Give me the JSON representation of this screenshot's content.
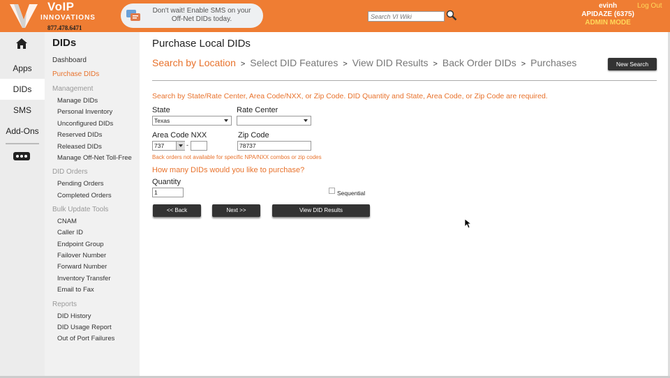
{
  "header": {
    "brand_name": "VoIP",
    "brand_sub": "INNOVATIONS",
    "brand_phone": "877.478.6471",
    "promo_line1": "Don't wait! Enable SMS on your",
    "promo_line2": "Off-Net DIDs today.",
    "search_placeholder": "Search VI Wiki",
    "user_name": "evinh",
    "account": "APIDAZE (6375)",
    "mode": "ADMIN MODE",
    "logout_label": "Log Out",
    "color_accent": "#ef7d33"
  },
  "icon_nav": {
    "home_icon": "home-icon",
    "items": [
      {
        "label": "Apps"
      },
      {
        "label": "DIDs"
      },
      {
        "label": "SMS"
      },
      {
        "label": "Add-Ons"
      }
    ],
    "more_icon": "more-dots-icon"
  },
  "sidebar": {
    "title": "DIDs",
    "dashboard": "Dashboard",
    "purchase": "Purchase DIDs",
    "management_head": "Management",
    "management": [
      "Manage DIDs",
      "Personal Inventory",
      "Unconfigured DIDs",
      "Reserved DIDs",
      "Released DIDs",
      "Manage Off-Net Toll-Free"
    ],
    "orders_head": "DID Orders",
    "orders": [
      "Pending Orders",
      "Completed Orders"
    ],
    "bulk_head": "Bulk Update Tools",
    "bulk": [
      "CNAM",
      "Caller ID",
      "Endpoint Group",
      "Failover Number",
      "Forward Number",
      "Inventory Transfer",
      "Email to Fax"
    ],
    "reports_head": "Reports",
    "reports": [
      "DID History",
      "DID Usage Report",
      "Out of Port Failures"
    ]
  },
  "main": {
    "title": "Purchase Local DIDs",
    "steps": [
      "Search by Location",
      "Select DID Features",
      "View DID Results",
      "Back Order DIDs",
      "Purchases"
    ],
    "step_sep": ">",
    "new_search": "New Search",
    "instructions": "Search by State/Rate Center, Area Code/NXX, or Zip Code. DID Quantity and State, Area Code, or Zip Code are required.",
    "state_label": "State",
    "state_value": "Texas",
    "rate_center_label": "Rate Center",
    "rate_center_value": "",
    "area_code_label": "Area Code NXX",
    "area_code_value": "737",
    "nxx_value": "",
    "dash": "-",
    "zip_label": "Zip Code",
    "zip_value": "78737",
    "note": "Back orders not available for specific NPA/NXX combos or zip codes",
    "question": "How many DIDs would you like to purchase?",
    "quantity_label": "Quantity",
    "quantity_value": "1",
    "sequential_label": "Sequential",
    "back_button": "<< Back",
    "next_button": "Next >>",
    "view_results_button": "View DID Results"
  }
}
